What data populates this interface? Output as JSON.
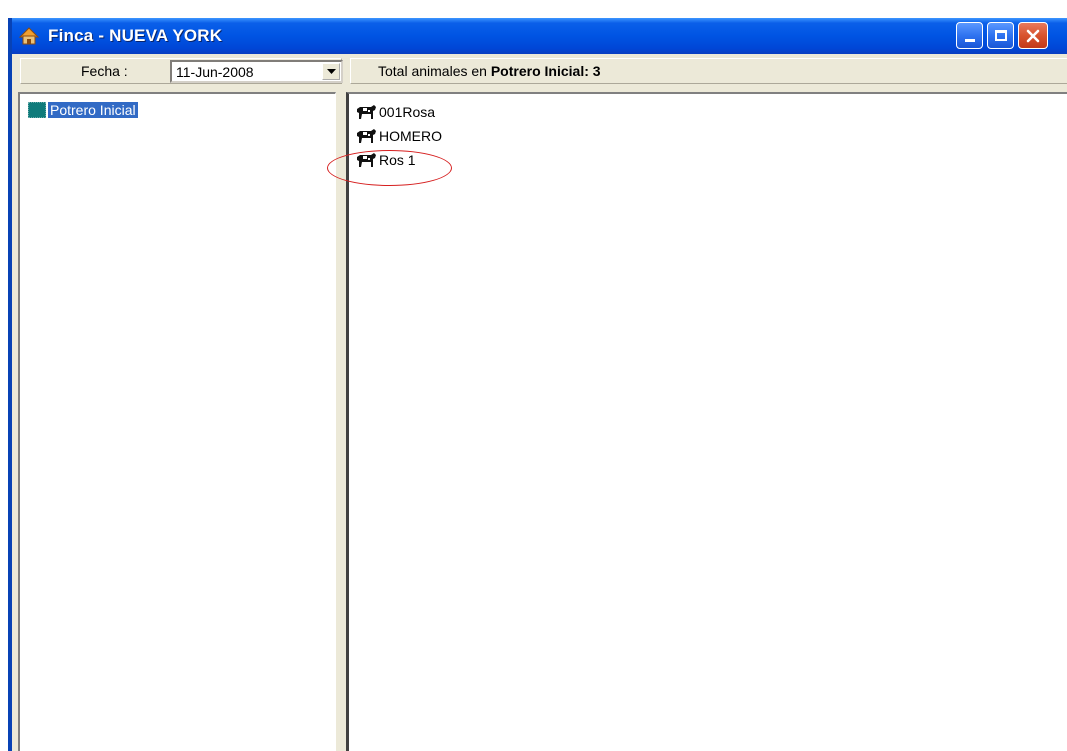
{
  "window": {
    "title": "Finca - NUEVA YORK"
  },
  "toolbar": {
    "fecha_label": "Fecha :",
    "fecha_value": "11-Jun-2008",
    "total_prefix": "Total animales en ",
    "total_strong": "Potrero Inicial: 3"
  },
  "tree": {
    "items": [
      {
        "label": "Potrero Inicial",
        "icon": "paddock-icon"
      }
    ]
  },
  "animals": {
    "items": [
      {
        "label": "001Rosa",
        "icon": "cow-icon"
      },
      {
        "label": "HOMERO",
        "icon": "cow-icon"
      },
      {
        "label": "Ros 1",
        "icon": "cow-icon"
      }
    ]
  },
  "colors": {
    "title_bar": "#0054e3",
    "selection": "#316ac5",
    "highlight_ellipse": "#d62020",
    "paddock_icon": "#0f7b7b"
  }
}
